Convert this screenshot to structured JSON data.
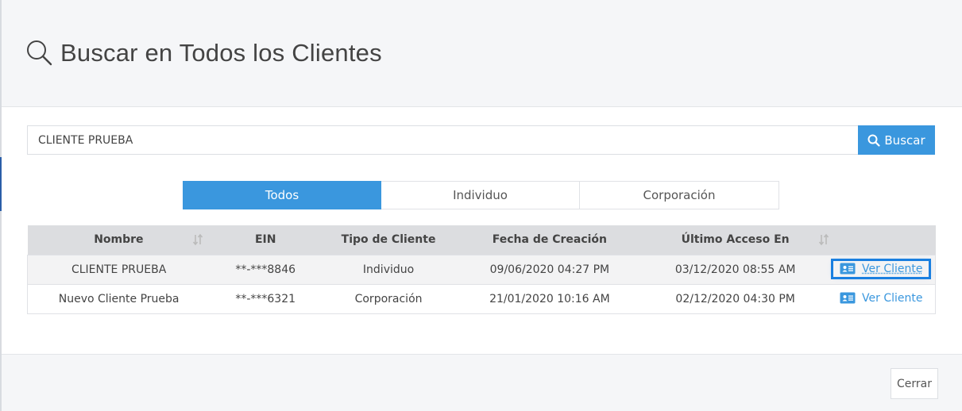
{
  "modal": {
    "title": "Buscar en Todos los Clientes"
  },
  "search": {
    "value": "CLIENTE PRUEBA",
    "button_label": "Buscar"
  },
  "tabs": [
    {
      "label": "Todos",
      "active": true
    },
    {
      "label": "Individuo",
      "active": false
    },
    {
      "label": "Corporación",
      "active": false
    }
  ],
  "table": {
    "headers": [
      "Nombre",
      "EIN",
      "Tipo de Cliente",
      "Fecha de Creación",
      "Último Acceso En",
      ""
    ],
    "rows": [
      {
        "nombre": "CLIENTE PRUEBA",
        "ein": "**-***8846",
        "tipo": "Individuo",
        "fecha": "09/06/2020 04:27 PM",
        "acceso": "03/12/2020 08:55 AM",
        "action": "Ver Cliente"
      },
      {
        "nombre": "Nuevo Cliente Prueba",
        "ein": "**-***6321",
        "tipo": "Corporación",
        "fecha": "21/01/2020 10:16 AM",
        "acceso": "02/12/2020 04:30 PM",
        "action": "Ver Cliente"
      }
    ]
  },
  "footer": {
    "close_label": "Cerrar"
  },
  "colors": {
    "accent": "#3a97de",
    "header_bg": "#f5f6f8",
    "table_header_bg": "#dcdde0"
  }
}
